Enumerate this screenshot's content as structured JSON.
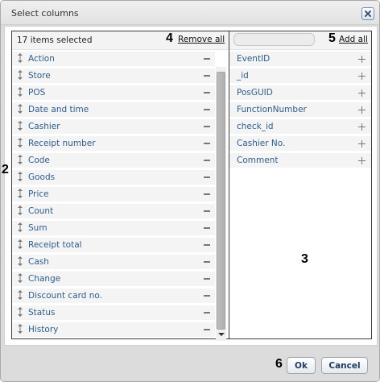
{
  "dialog": {
    "title": "Select columns",
    "close_icon": "close-icon"
  },
  "left_panel": {
    "selected_count": "17 items selected",
    "remove_all_label": "Remove all",
    "items": [
      "Action",
      "Store",
      "POS",
      "Date and time",
      "Cashier",
      "Receipt number",
      "Code",
      "Goods",
      "Price",
      "Count",
      "Sum",
      "Receipt total",
      "Cash",
      "Change",
      "Discount card no.",
      "Status",
      "History"
    ]
  },
  "right_panel": {
    "search_placeholder": "",
    "add_all_label": "Add all",
    "items": [
      "EventID",
      "_id",
      "PosGUID",
      "FunctionNumber",
      "check_id",
      "Cashier No.",
      "Comment"
    ]
  },
  "footer": {
    "ok_label": "Ok",
    "cancel_label": "Cancel"
  },
  "callouts": {
    "c2": "2",
    "c3": "3",
    "c4": "4",
    "c5": "5",
    "c6": "6"
  }
}
